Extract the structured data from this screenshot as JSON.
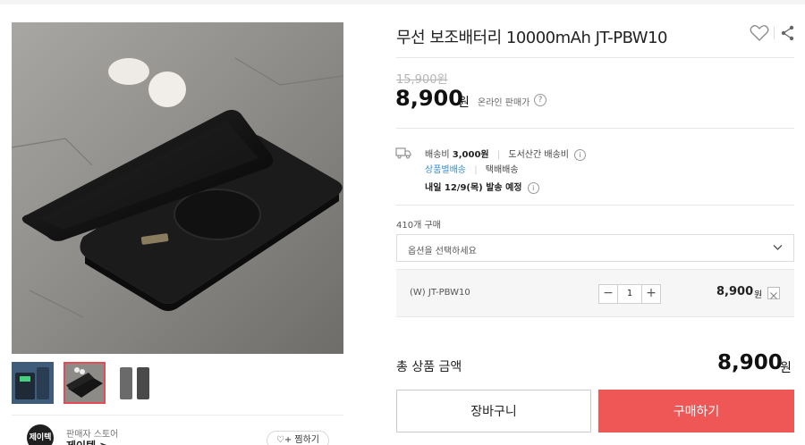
{
  "product": {
    "title": "무선 보조배터리 10000mAh JT-PBW10",
    "original_price": "15,900원",
    "sale_price": "8,900",
    "currency": "원",
    "online_price_label": "온라인 판매가",
    "help_mark": "?"
  },
  "shipping": {
    "fee_label": "배송비",
    "fee_value": "3,000원",
    "remote_label": "도서산간 배송비",
    "method_link": "상품별배송",
    "method_type": "택배배송",
    "dispatch_text": "내일 12/9(목) 발송 예정",
    "info_mark": "i"
  },
  "purchase": {
    "count_text": "410개 구매"
  },
  "option_select": {
    "placeholder": "옵션을 선택하세요"
  },
  "selected_option": {
    "name": "(W) JT-PBW10",
    "quantity": "1",
    "minus": "−",
    "plus": "+",
    "price": "8,900",
    "unit": "원"
  },
  "total": {
    "label": "총 상품 금액",
    "price": "8,900",
    "unit": "원"
  },
  "actions": {
    "cart_label": "장바구니",
    "buy_label": "구매하기"
  },
  "seller": {
    "logo_text": "제이텍",
    "caption": "판매자 스토어",
    "name": "제이텍 >",
    "follow_label": "찜하기"
  },
  "thumbnails": [
    {
      "icon": "charging-phone-thumb"
    },
    {
      "icon": "powerbank-with-phone-thumb"
    },
    {
      "icon": "powerbank-side-thumb"
    }
  ],
  "colors": {
    "accent": "#ef5656",
    "link_blue": "#3a8fd0",
    "thumb_active_border": "#e84a55"
  }
}
